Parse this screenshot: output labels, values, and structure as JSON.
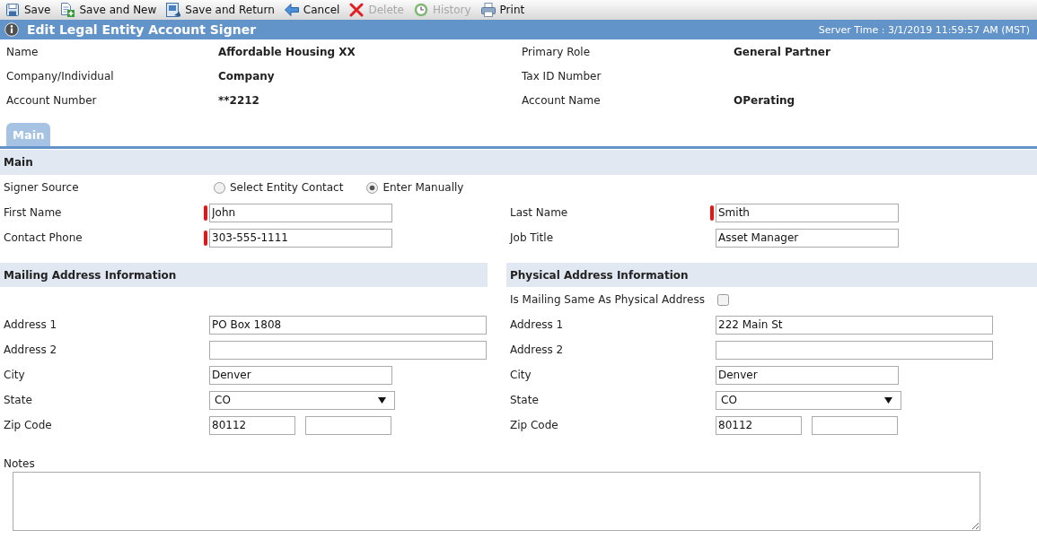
{
  "toolbar": [
    {
      "label": "Save",
      "disabled": false
    },
    {
      "label": "Save and New",
      "disabled": false
    },
    {
      "label": "Save and Return",
      "disabled": false
    },
    {
      "label": "Cancel",
      "disabled": false
    },
    {
      "label": "Delete",
      "disabled": true
    },
    {
      "label": "History",
      "disabled": true
    },
    {
      "label": "Print",
      "disabled": false
    }
  ],
  "title_bar": {
    "title": "Edit Legal Entity Account Signer",
    "server_time": "Server Time : 3/1/2019 11:59:57 AM (MST)"
  },
  "details": [
    {
      "label": "Name",
      "value": "Affordable Housing XX"
    },
    {
      "label": "Primary Role",
      "value": "General Partner"
    },
    {
      "label": "Company/Individual",
      "value": "Company"
    },
    {
      "label": "Tax ID Number"
    },
    {
      "label": "Account Number",
      "value": "**2212"
    },
    {
      "label": "Account Name",
      "value": "OPerating"
    }
  ],
  "tabs": [
    {
      "label": "Main",
      "selected": true
    }
  ],
  "main_section": {
    "title": "Main",
    "signer_source": {
      "label": "Signer Source",
      "options": [
        {
          "label": "Select Entity Contact",
          "selected": false
        },
        {
          "label": "Enter Manually",
          "selected": true
        }
      ]
    },
    "fields": [
      {
        "label": "First Name",
        "value": "John",
        "required": true
      },
      {
        "label": "Last Name",
        "value": "Smith",
        "required": true
      },
      {
        "label": "Contact Phone",
        "value": "303-555-1111",
        "required": true
      },
      {
        "label": "Job Title",
        "value": "Asset Manager",
        "required": false
      }
    ]
  },
  "address_sections": [
    {
      "title": "Mailing Address Information",
      "fields": [
        {
          "kind": "wide",
          "label": "Address 1",
          "value": "PO Box 1808"
        },
        {
          "kind": "wide",
          "label": "Address 2"
        },
        {
          "kind": "text",
          "label": "City",
          "value": "Denver"
        },
        {
          "kind": "select",
          "label": "State",
          "value": "CO"
        },
        {
          "kind": "zip",
          "label": "Zip Code",
          "value": "80112"
        }
      ]
    },
    {
      "title": "Physical Address Information",
      "same_as_mailing": {
        "label": "Is Mailing Same As Physical Address",
        "checked": false
      },
      "fields": [
        {
          "kind": "wide",
          "label": "Address 1",
          "value": "222 Main St"
        },
        {
          "kind": "wide",
          "label": "Address 2"
        },
        {
          "kind": "text",
          "label": "City",
          "value": "Denver"
        },
        {
          "kind": "select",
          "label": "State",
          "value": "CO"
        },
        {
          "kind": "zip",
          "label": "Zip Code",
          "value": "80112"
        }
      ]
    }
  ],
  "notes": {
    "label": "Notes"
  }
}
